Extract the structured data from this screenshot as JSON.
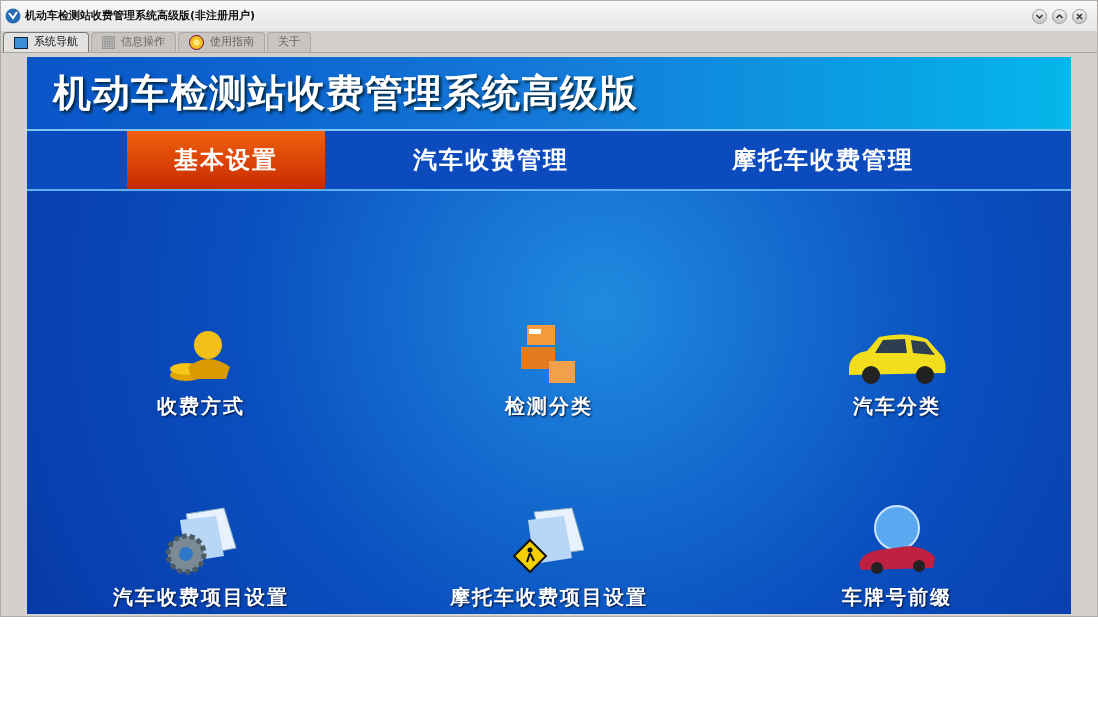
{
  "window": {
    "title": "机动车检测站收费管理系统高级版(非注册用户)"
  },
  "tabs": [
    {
      "label": "系统导航",
      "kind": "monitor",
      "selected": true
    },
    {
      "label": "信息操作",
      "kind": "grid",
      "selected": false
    },
    {
      "label": "使用指南",
      "kind": "help",
      "selected": false
    },
    {
      "label": "关于",
      "kind": "none",
      "selected": false
    }
  ],
  "banner": {
    "title": "机动车检测站收费管理系统高级版"
  },
  "nav": [
    {
      "label": "基本设置",
      "selected": true
    },
    {
      "label": "汽车收费管理",
      "selected": false
    },
    {
      "label": "摩托车收费管理",
      "selected": false
    }
  ],
  "tiles": [
    {
      "label": "收费方式",
      "kind": "coins"
    },
    {
      "label": "检测分类",
      "kind": "boxes"
    },
    {
      "label": "汽车分类",
      "kind": "car"
    },
    {
      "label": "汽车收费项目设置",
      "kind": "gear-doc"
    },
    {
      "label": "摩托车收费项目设置",
      "kind": "sign-doc"
    },
    {
      "label": "车牌号前缀",
      "kind": "globe-car"
    }
  ]
}
